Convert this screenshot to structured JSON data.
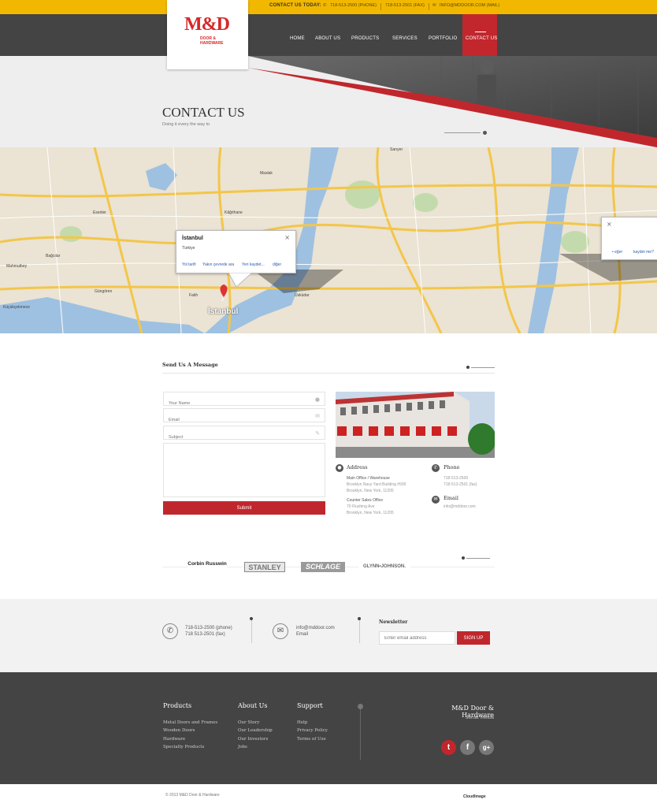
{
  "topbar": {
    "contact_label": "CONTACT US TODAY:",
    "phone": "718-513-2500 (PHONE)",
    "fax": "718-513-2501 (FAX)",
    "mail": "INFO@MDDOOR.COM (MAIL)"
  },
  "logo": {
    "mark": "M&D",
    "sub": "DOOR & HARDWARE"
  },
  "nav": [
    "HOME",
    "ABOUT US",
    "PRODUCTS",
    "SERVICES",
    "PORTFOLIO",
    "CONTACT US"
  ],
  "hero": {
    "title": "CONTACT US",
    "subtitle": "Doing it every the way to"
  },
  "map": {
    "popup_title": "İstanbul",
    "popup_sub": "Türkiye",
    "popup_links": [
      "Yol tarifi",
      "Yakın çevrede ara",
      "Yeri kaydet...",
      "diğer"
    ],
    "side_links": [
      "• eğer",
      "kaydet me?"
    ],
    "city_label": "İstanbul",
    "marker": "A",
    "places": [
      "Esenler",
      "Bağcılar",
      "Mahmutbey",
      "Küçükçekmece",
      "Güngören",
      "Fatih",
      "Üsküdar",
      "Maslak",
      "Kâğıthane",
      "Sarıyer"
    ]
  },
  "message": {
    "title": "Send Us A Message",
    "name_placeholder": "Your Name",
    "email_placeholder": "Email",
    "subject_placeholder": "Subject",
    "submit": "Submit"
  },
  "info": {
    "address_h": "Address",
    "addr1_label": "Main Office / Warehouse",
    "addr1_l1": "Brooklyn Navy Yard Building #500",
    "addr1_l2": "Brooklyn, New York, 11205",
    "addr2_label": "Counter Sales Office",
    "addr2_l1": "70 Flushing Ave",
    "addr2_l2": "Brooklyn, New York, 11205",
    "phone_h": "Phone",
    "phone_1": "718-513-2500",
    "phone_2": "718-513-2501 (fax)",
    "email_h": "Email",
    "email_v": "info@mddoor.com"
  },
  "brands": [
    "Corbin Russwin",
    "STANLEY",
    "SCHLAGE",
    "GLYNN•JOHNSON."
  ],
  "band": {
    "phone_1": "718-513-2500 (phone)",
    "phone_2": "718 513-2501 (fax)",
    "email_1": "info@mddoor.com",
    "email_2": "Email",
    "newsletter": "Newsletter",
    "email_placeholder": "Enter email address",
    "signup": "SIGN UP"
  },
  "footer": {
    "products_h": "Products",
    "products": [
      "Metal Doors and Frames",
      "Wooden Doors",
      "Hardware",
      "Specialty Products"
    ],
    "about_h": "About Us",
    "about": [
      "Our Story",
      "Our Leadership",
      "Our Investors",
      "Jobs"
    ],
    "support_h": "Support",
    "support": [
      "Help",
      "Privacy Policy",
      "Terms of Use"
    ],
    "brand_name": "M&D Door & Hardware",
    "social_h": "Social Media",
    "social": [
      "t",
      "f",
      "g+"
    ],
    "copyright": "© 2013 M&D Door & Hardware",
    "designer": "CloudImage"
  },
  "colors": {
    "accent": "#c0272d",
    "topbar": "#f2b800",
    "dark": "#444444"
  }
}
